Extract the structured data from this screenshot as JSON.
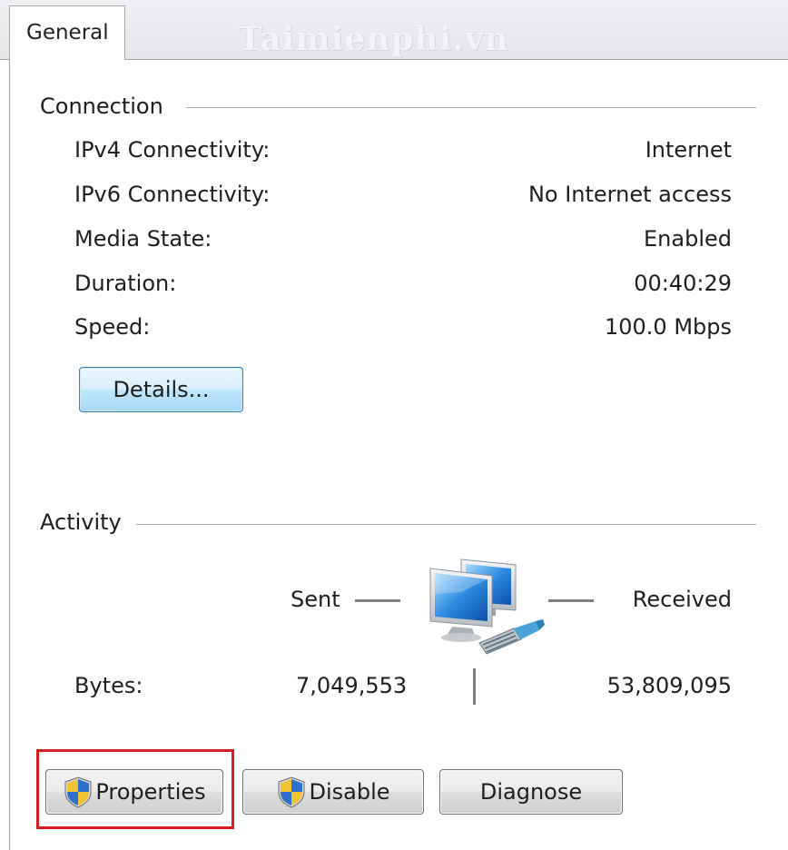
{
  "tabs": [
    {
      "label": "General"
    }
  ],
  "watermark": "Taimienphi.vn",
  "connection": {
    "title": "Connection",
    "rows": [
      {
        "label": "IPv4 Connectivity:",
        "value": "Internet"
      },
      {
        "label": "IPv6 Connectivity:",
        "value": "No Internet access"
      },
      {
        "label": "Media State:",
        "value": "Enabled"
      },
      {
        "label": "Duration:",
        "value": "00:40:29"
      },
      {
        "label": "Speed:",
        "value": "100.0 Mbps"
      }
    ],
    "details_button": "Details..."
  },
  "activity": {
    "title": "Activity",
    "sent_label": "Sent",
    "received_label": "Received",
    "bytes_label": "Bytes:",
    "bytes_sent": "7,049,553",
    "bytes_received": "53,809,095"
  },
  "buttons": {
    "properties": "Properties",
    "disable": "Disable",
    "diagnose": "Diagnose"
  },
  "icons": {
    "network": "network-computers-icon",
    "shield": "uac-shield-icon"
  },
  "colors": {
    "highlight": "#d81e1e",
    "details_button_border": "#3c7fb1"
  }
}
